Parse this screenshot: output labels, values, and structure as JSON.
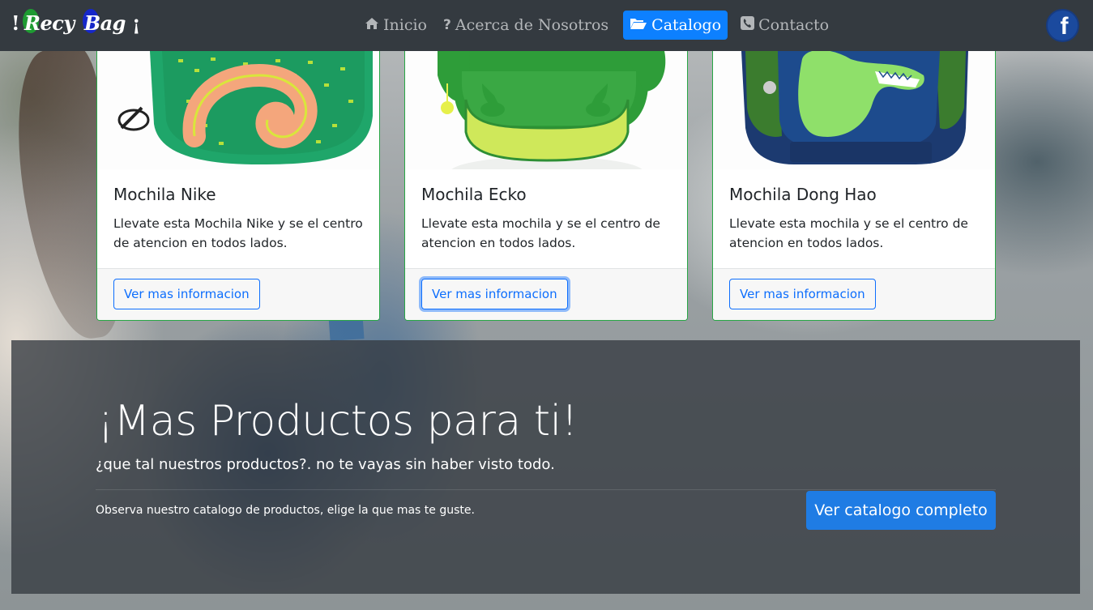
{
  "brand": {
    "mark_open": "!",
    "word1": "Recy",
    "word2": "Bag",
    "mark_close": "¡"
  },
  "nav": {
    "items": [
      {
        "label": "Inicio",
        "icon": "home-icon",
        "active": false
      },
      {
        "label": "Acerca de Nosotros",
        "icon": "question-icon",
        "active": false
      },
      {
        "label": "Catalogo",
        "icon": "folder-open-icon",
        "active": true
      },
      {
        "label": "Contacto",
        "icon": "phone-icon",
        "active": false
      }
    ],
    "social_icon": "facebook-icon",
    "social_letter": "f"
  },
  "cards": [
    {
      "title": "Mochila Nike",
      "text": "Llevate esta Mochila Nike y se el centro de atencion en todos lados.",
      "button": "Ver mas informacion"
    },
    {
      "title": "Mochila Ecko",
      "text": "Llevate esta mochila y se el centro de atencion en todos lados.",
      "button": "Ver mas informacion"
    },
    {
      "title": "Mochila Dong Hao",
      "text": "Llevate esta mochila y se el centro de atencion en todos lados.",
      "button": "Ver mas informacion"
    }
  ],
  "jumbotron": {
    "title": "¡Mas Productos para ti!",
    "lead": "¿que tal nuestros productos?. no te vayas sin haber visto todo.",
    "text": "Observa nuestro catalogo de productos, elige la que mas te guste.",
    "button": "Ver catalogo completo"
  },
  "colors": {
    "navbar": "#343a40",
    "active": "#0d80ff",
    "card_border": "#28a745",
    "primary": "#1f7ce4"
  }
}
